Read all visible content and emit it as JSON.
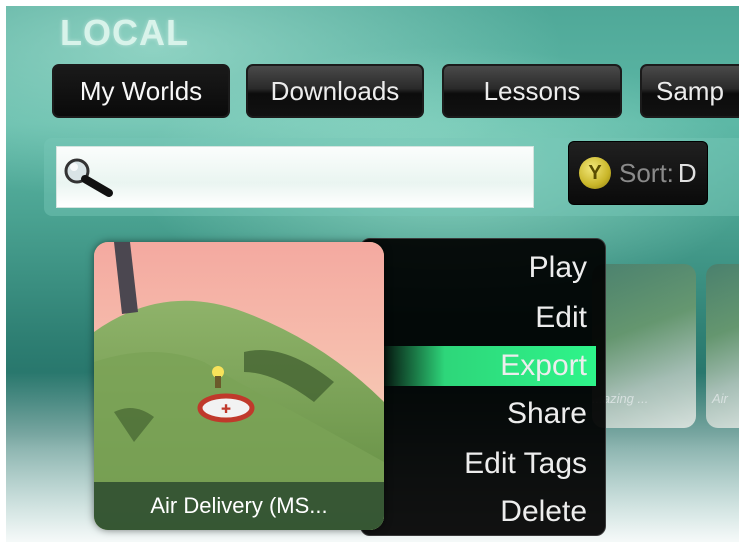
{
  "section_title": "LOCAL",
  "tabs": [
    {
      "label": "My Worlds",
      "active": true
    },
    {
      "label": "Downloads",
      "active": false
    },
    {
      "label": "Lessons",
      "active": false
    },
    {
      "label": "Samp",
      "active": false
    }
  ],
  "search": {
    "value": "",
    "placeholder": "",
    "icon": "magnifier-icon"
  },
  "sort": {
    "button_glyph": "Y",
    "label": "Sort:",
    "value": "D",
    "icon": "y-button-icon"
  },
  "selected_world": {
    "title": "Air Delivery (MS..."
  },
  "background_worlds": [
    {
      "title": "...azing ..."
    },
    {
      "title": "Air"
    }
  ],
  "context_menu": {
    "items": [
      "Play",
      "Edit",
      "Export",
      "Share",
      "Edit Tags",
      "Delete"
    ],
    "highlighted": "Export"
  },
  "colors": {
    "background": "#4fa898",
    "highlight": "#2ef58a",
    "menu_bg": "#000000",
    "title": "#d8f3ea"
  }
}
